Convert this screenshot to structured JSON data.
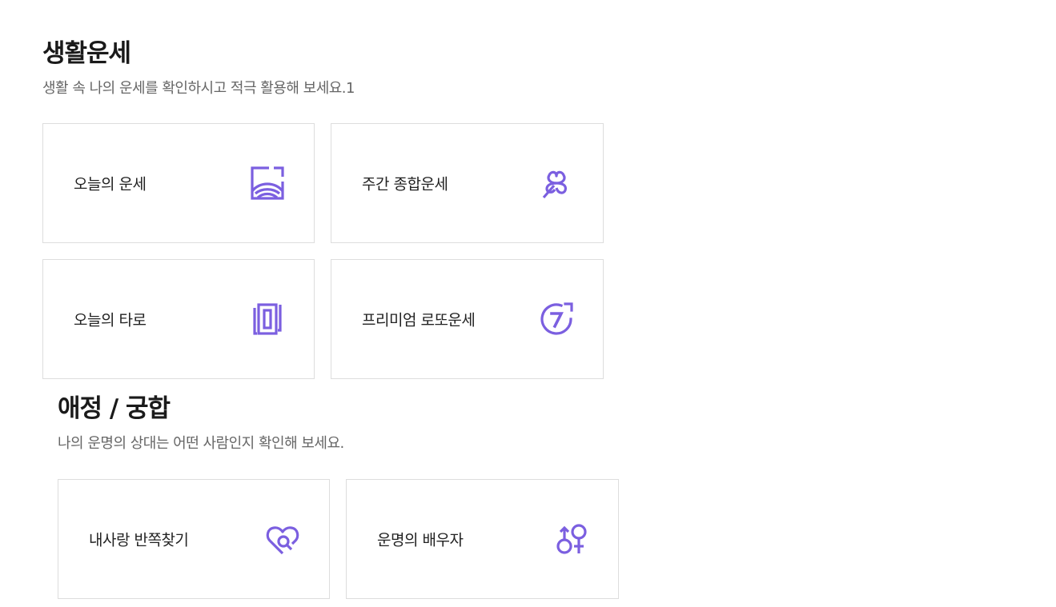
{
  "accent_color": "#7b5fe0",
  "life": {
    "title": "생활운세",
    "desc": "생활 속 나의 운세를 확인하시고 적극 활용해 보세요.1",
    "items": [
      {
        "label": "오늘의 운세",
        "icon": "window-hills-icon"
      },
      {
        "label": "주간 종합운세",
        "icon": "clover-icon"
      },
      {
        "label": "오늘의 타로",
        "icon": "tarot-card-icon"
      },
      {
        "label": "프리미엄 로또운세",
        "icon": "lotto-seven-icon"
      }
    ]
  },
  "love": {
    "title": "애정 / 궁합",
    "desc": "나의 운명의 상대는 어떤 사람인지 확인해 보세요.",
    "items": [
      {
        "label": "내사랑 반쪽찾기",
        "icon": "heart-search-icon"
      },
      {
        "label": "운명의 배우자",
        "icon": "gender-symbols-icon"
      }
    ]
  }
}
